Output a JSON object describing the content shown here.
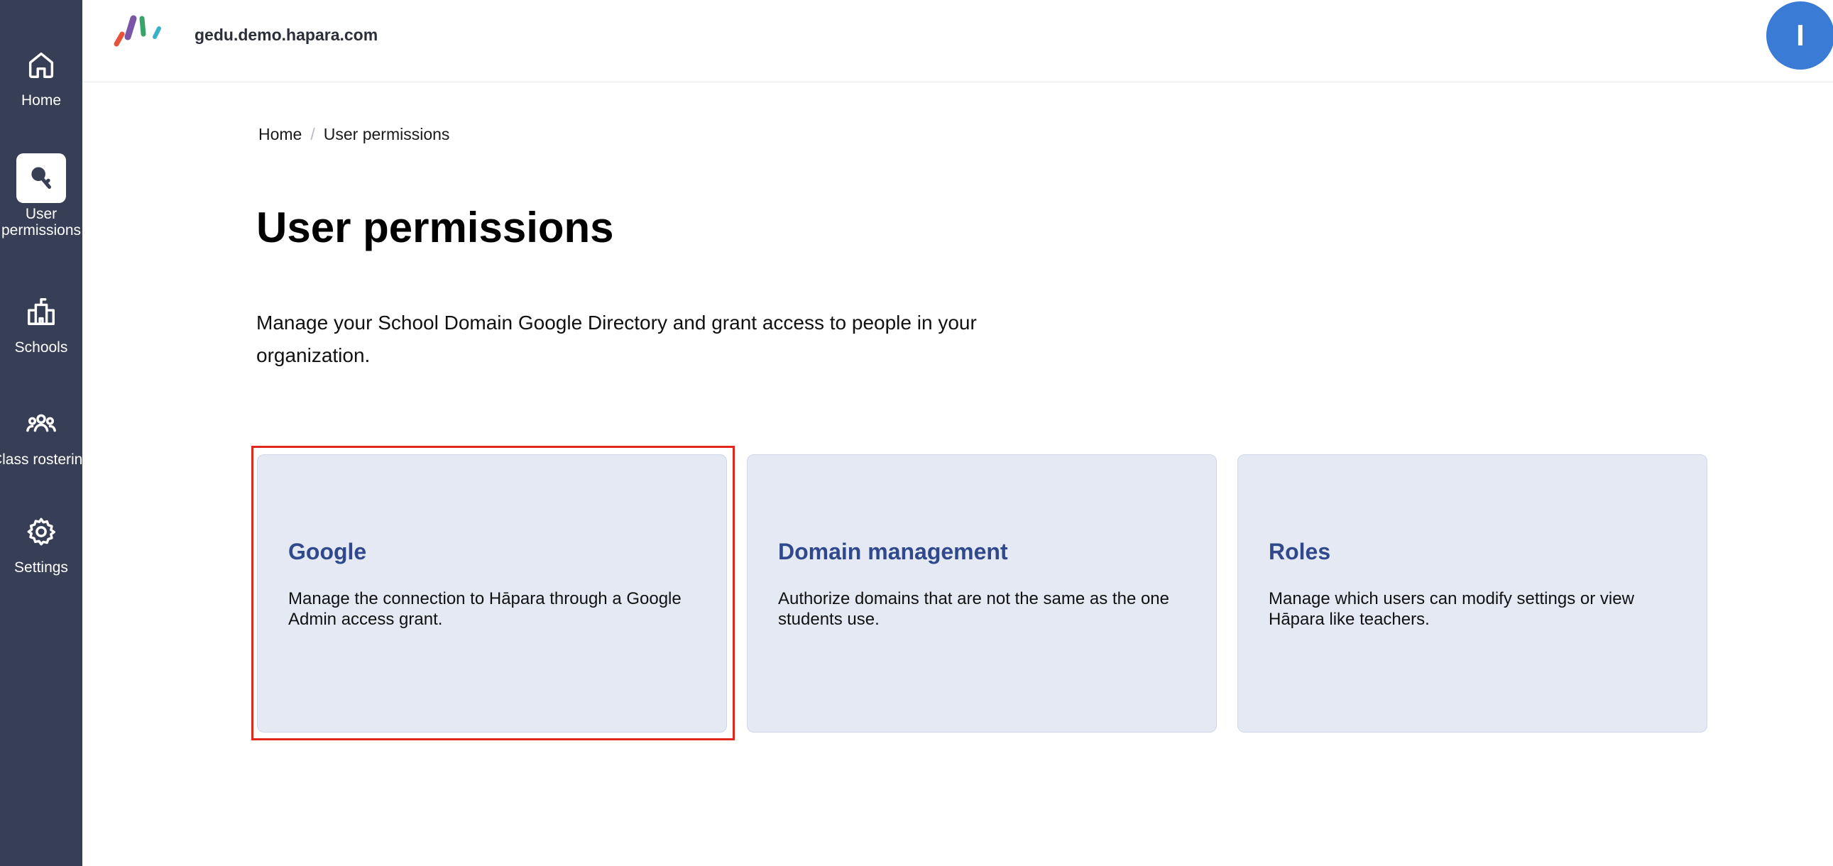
{
  "header": {
    "domain": "gedu.demo.hapara.com",
    "avatar_initial": "I",
    "avatar_color": "#3a7bd5"
  },
  "sidebar": {
    "background": "#363f55",
    "items": [
      {
        "label": "Home",
        "icon": "home-icon",
        "active": false
      },
      {
        "label": "User permissions",
        "icon": "key-icon",
        "active": true
      },
      {
        "label": "Schools",
        "icon": "school-building-icon",
        "active": false
      },
      {
        "label": "Class rostering",
        "icon": "group-icon",
        "active": false
      },
      {
        "label": "Settings",
        "icon": "gear-icon",
        "active": false
      }
    ]
  },
  "breadcrumb": {
    "items": [
      "Home",
      "User permissions"
    ]
  },
  "page": {
    "title": "User permissions",
    "description": "Manage your School Domain Google Directory and grant access to people in your organization."
  },
  "cards": [
    {
      "title": "Google",
      "description": "Manage the connection to Hāpara through a Google Admin access grant.",
      "highlighted": true
    },
    {
      "title": "Domain management",
      "description": "Authorize domains that are not the same as the one students use.",
      "highlighted": false
    },
    {
      "title": "Roles",
      "description": "Manage which users can modify settings or view Hāpara like teachers.",
      "highlighted": false
    }
  ],
  "colors": {
    "card_background": "#e4e9f3",
    "card_title": "#30488c",
    "highlight_border": "#e0281e"
  }
}
